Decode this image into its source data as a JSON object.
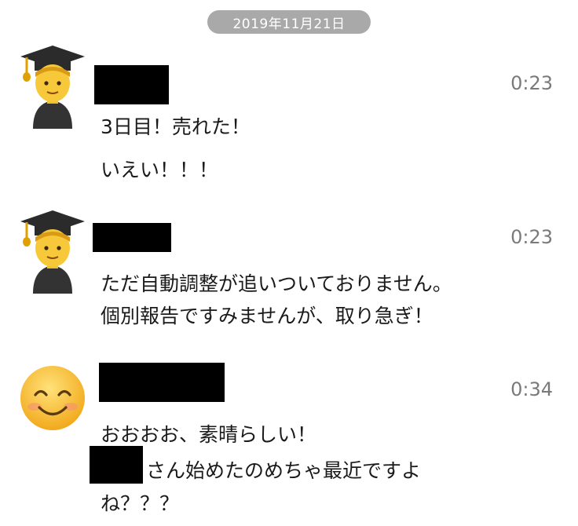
{
  "date_separator": "2019年11月21日",
  "messages": [
    {
      "avatar": "student-emoji",
      "time": "0:23",
      "lines": [
        "3日目！売れた！",
        "いえい！！！"
      ]
    },
    {
      "avatar": "student-emoji",
      "time": "0:23",
      "lines": [
        "ただ自動調整が追いついておりません。",
        "個別報告ですみませんが、取り急ぎ！"
      ]
    },
    {
      "avatar": "smiling-face-emoji",
      "time": "0:34",
      "lines": [
        "おおおお、素晴らしい！",
        "さん始めたのめちゃ最近ですよ",
        "ね？？？"
      ]
    }
  ]
}
